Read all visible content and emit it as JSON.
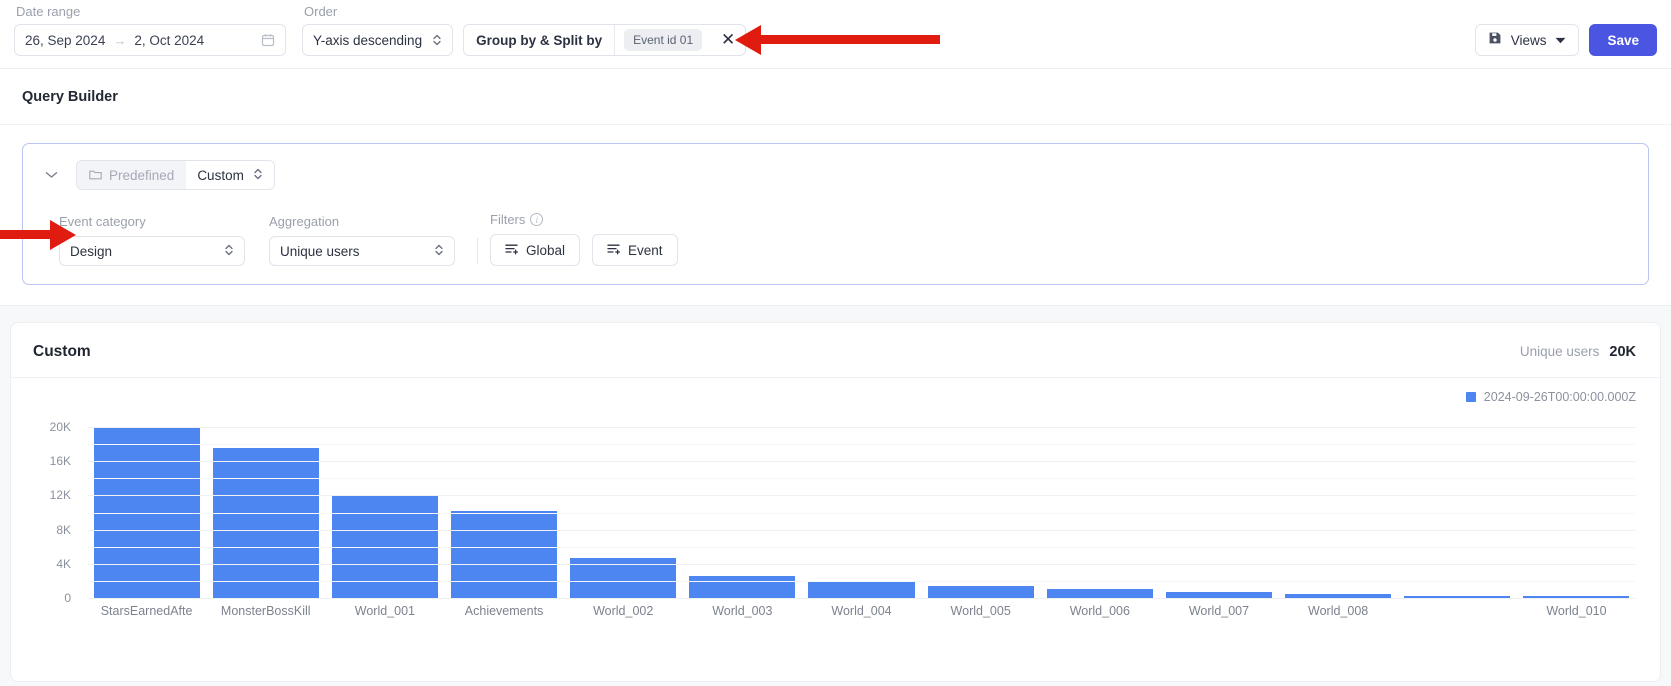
{
  "topbar": {
    "date_range_label": "Date range",
    "date_start": "26, Sep 2024",
    "date_arrow": "→",
    "date_end": "2, Oct 2024",
    "calendar_icon": "calendar-icon",
    "order_label": "Order",
    "order_value": "Y-axis descending",
    "groupby_label": "Group by & Split by",
    "groupby_chip": "Event id 01",
    "close_icon": "✕",
    "views_label": "Views",
    "views_icon": "save-disk-icon",
    "views_caret": "▼",
    "save_label": "Save"
  },
  "query_builder": {
    "title": "Query Builder",
    "collapse_caret": "⌄",
    "segment_predefined": "Predefined",
    "segment_predefined_icon": "folder-icon",
    "segment_custom": "Custom",
    "event_category_label": "Event category",
    "event_category_value": "Design",
    "aggregation_label": "Aggregation",
    "aggregation_value": "Unique users",
    "filters_label": "Filters",
    "filters_info_icon": "info-icon",
    "filter_global": "Global",
    "filter_event": "Event",
    "filter_icon": "filter-plus-icon"
  },
  "chart_panel": {
    "title": "Custom",
    "metric_label": "Unique users",
    "metric_value": "20K"
  },
  "chart_data": {
    "type": "bar",
    "title": "Custom",
    "xlabel": "",
    "ylabel": "",
    "ylim": [
      0,
      22000
    ],
    "grid": true,
    "legend_position": "top-right",
    "legend": [
      "2024-09-26T00:00:00.000Z"
    ],
    "series_color": "#4d86f0",
    "y_ticks": [
      "0",
      "4K",
      "8K",
      "12K",
      "16K",
      "20K"
    ],
    "y_tick_values": [
      0,
      4000,
      8000,
      12000,
      16000,
      20000
    ],
    "categories": [
      "StarsEarnedAfte",
      "MonsterBossKill",
      "World_001",
      "Achievements",
      "World_002",
      "World_003",
      "World_004",
      "World_005",
      "World_006",
      "World_007",
      "World_008",
      "",
      "World_010"
    ],
    "values": [
      20000,
      17600,
      12000,
      10200,
      4700,
      2600,
      1900,
      1350,
      1000,
      720,
      480,
      260,
      120
    ]
  }
}
